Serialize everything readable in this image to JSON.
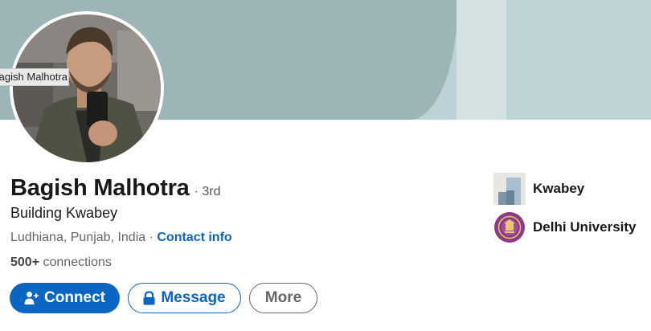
{
  "profile": {
    "name": "Bagish Malhotra",
    "degree": "· 3rd",
    "headline": "Building Kwabey",
    "location": "Ludhiana, Punjab, India",
    "separator": " · ",
    "contact_info": "Contact info",
    "connections_count": "500+",
    "connections_label": " connections",
    "avatar_tooltip": "Bagish Malhotra"
  },
  "actions": {
    "connect": "Connect",
    "message": "Message",
    "more": "More"
  },
  "experience": {
    "company": "Kwabey",
    "school": "Delhi University"
  },
  "colors": {
    "primary_blue": "#0a66c2",
    "banner_left": "#9eb5b8",
    "banner_right": "#bfd4d7"
  },
  "icons": {
    "connect": "add-person-icon",
    "message": "lock-icon",
    "company": "kwabey-logo",
    "school": "delhi-university-seal"
  }
}
